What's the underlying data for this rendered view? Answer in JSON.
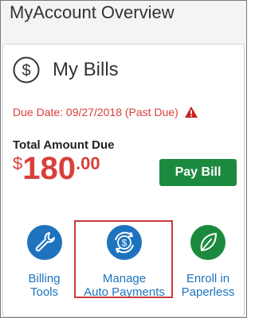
{
  "page": {
    "title": "MyAccount Overview"
  },
  "bills_card": {
    "title": "My Bills",
    "icon": "dollar-circle-icon",
    "due_text": "Due Date: 09/27/2018 (Past Due)",
    "warning_icon": "warning-triangle-icon",
    "total_label": "Total Amount Due",
    "amount": {
      "currency_symbol": "$",
      "dollars": "180",
      "cents": ".00"
    },
    "pay_button_label": "Pay Bill"
  },
  "actions": [
    {
      "icon": "wrench-icon",
      "line1": "Billing",
      "line2": "Tools"
    },
    {
      "icon": "dollar-cycle-icon",
      "line1": "Manage",
      "line2": "Auto Payments"
    },
    {
      "icon": "leaf-icon",
      "line1": "Enroll in",
      "line2": "Paperless"
    }
  ],
  "colors": {
    "accent_blue": "#1e73be",
    "green": "#1c8a3e",
    "alert_red": "#d9403a"
  }
}
